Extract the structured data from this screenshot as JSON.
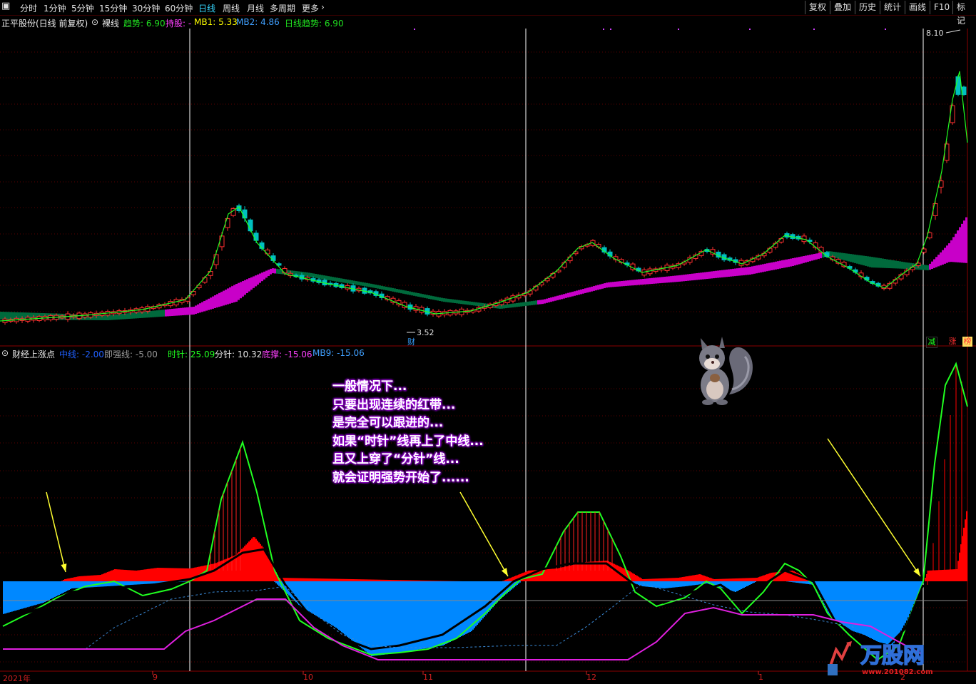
{
  "toolbar": {
    "periods": [
      "分时",
      "1分钟",
      "5分钟",
      "15分钟",
      "30分钟",
      "60分钟",
      "日线",
      "周线",
      "月线",
      "多周期",
      "更多"
    ],
    "active": "日线",
    "right_buttons": [
      "复权",
      "叠加",
      "历史",
      "统计",
      "画线",
      "F10",
      "标记"
    ]
  },
  "info": {
    "stock_title": "正平股份(日线 前复权)",
    "mode": "裸线",
    "trend_label": "趋势: 6.90",
    "hold_label": "持股: -",
    "mb1_label": "MB1: 5.33",
    "mb2_label": "MB2: 4.86",
    "day_trend_label": "日线趋势: 6.90",
    "high_price": "8.10",
    "low_price": "3.52",
    "fin_marker": "财"
  },
  "indicator": {
    "name": "财经上涨点",
    "mid_label": "中线: -2.00",
    "weak_label": "即强线: -5.00",
    "hour_label": "时针: 25.09",
    "minute_label": "分针: 10.32",
    "support_label": "底撑: -15.06",
    "mb9_label": "MB9: -15.06"
  },
  "note_lines": [
    "一般情况下...",
    "只要出现连续的红带...",
    "是完全可以跟进的...",
    "如果“时针”线再上了中线...",
    "且又上穿了“分针”线...",
    "就会证明强势开始了......"
  ],
  "x_labels": [
    "2021年",
    "9",
    "10",
    "11",
    "12",
    "1",
    "2"
  ],
  "side_buttons": [
    "减",
    "涨",
    "榜"
  ],
  "watermark": {
    "brand": "万股网",
    "url": "www.201082.com"
  },
  "colors": {
    "up": "#ff3030",
    "down": "#00c0c0",
    "band_up": "#c800c8",
    "band_down": "#006a3c",
    "trend_line": "#20ff20",
    "mid_band_red": "#ff0000",
    "mid_band_blue": "#0088ff",
    "support_line": "#e020e0",
    "dashed_line": "#3a8ad8",
    "accent_cyan": "#36d7ff"
  }
}
